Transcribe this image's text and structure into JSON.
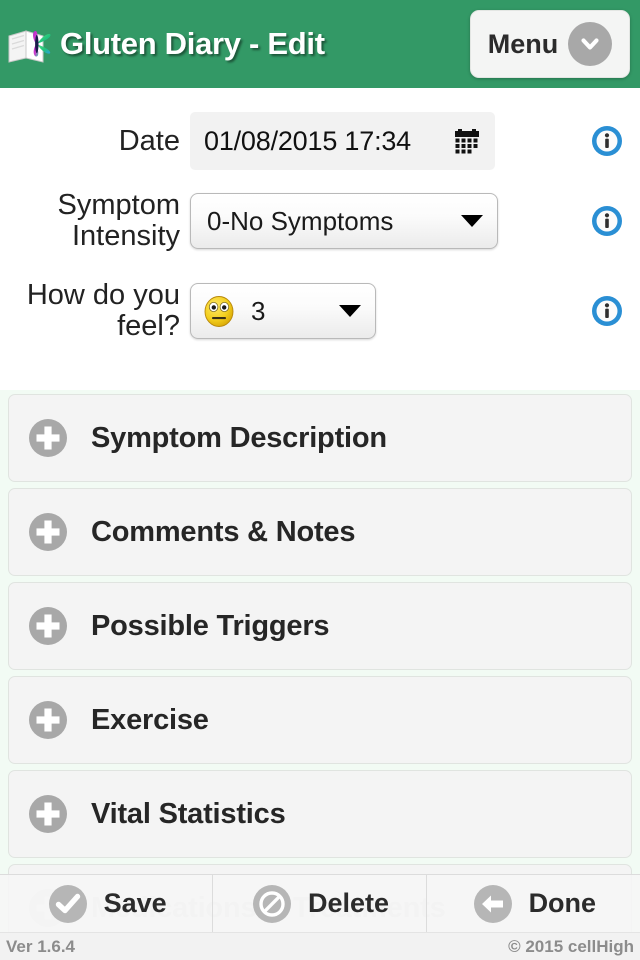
{
  "header": {
    "logo_icon": "book-butterfly-logo-icon",
    "title": "Gluten Diary - Edit",
    "menu_label": "Menu",
    "menu_icon": "chevron-down-icon",
    "background_color": "#339966"
  },
  "form": {
    "date": {
      "label": "Date",
      "value": "01/08/2015 17:34",
      "calendar_icon": "calendar-icon",
      "info_icon": "info-icon"
    },
    "symptom_intensity": {
      "label": "Symptom Intensity",
      "value": "0-No Symptoms",
      "caret_icon": "chevron-down-icon",
      "info_icon": "info-icon"
    },
    "how_do_you_feel": {
      "label": "How do you feel?",
      "value": "3",
      "emoji_icon": "neutral-face-emoji-icon",
      "caret_icon": "chevron-down-icon",
      "info_icon": "info-icon"
    }
  },
  "sections": [
    {
      "label": "Symptom Description",
      "icon": "plus-circle-icon"
    },
    {
      "label": "Comments & Notes",
      "icon": "plus-circle-icon"
    },
    {
      "label": "Possible Triggers",
      "icon": "plus-circle-icon"
    },
    {
      "label": "Exercise",
      "icon": "plus-circle-icon"
    },
    {
      "label": "Vital Statistics",
      "icon": "plus-circle-icon"
    },
    {
      "label": "Medications & Treatments",
      "icon": "plus-circle-icon"
    }
  ],
  "toolbar": {
    "save_label": "Save",
    "save_icon": "check-circle-icon",
    "delete_label": "Delete",
    "delete_icon": "prohibition-circle-icon",
    "done_label": "Done",
    "done_icon": "arrow-left-circle-icon"
  },
  "footer": {
    "version": "Ver 1.6.4",
    "copyright": "© 2015 cellHigh"
  },
  "colors": {
    "brand_green": "#339966",
    "info_blue": "#2a8fd4",
    "icon_gray": "#a8a8a8",
    "emoji_yellow": "#f2d024"
  }
}
